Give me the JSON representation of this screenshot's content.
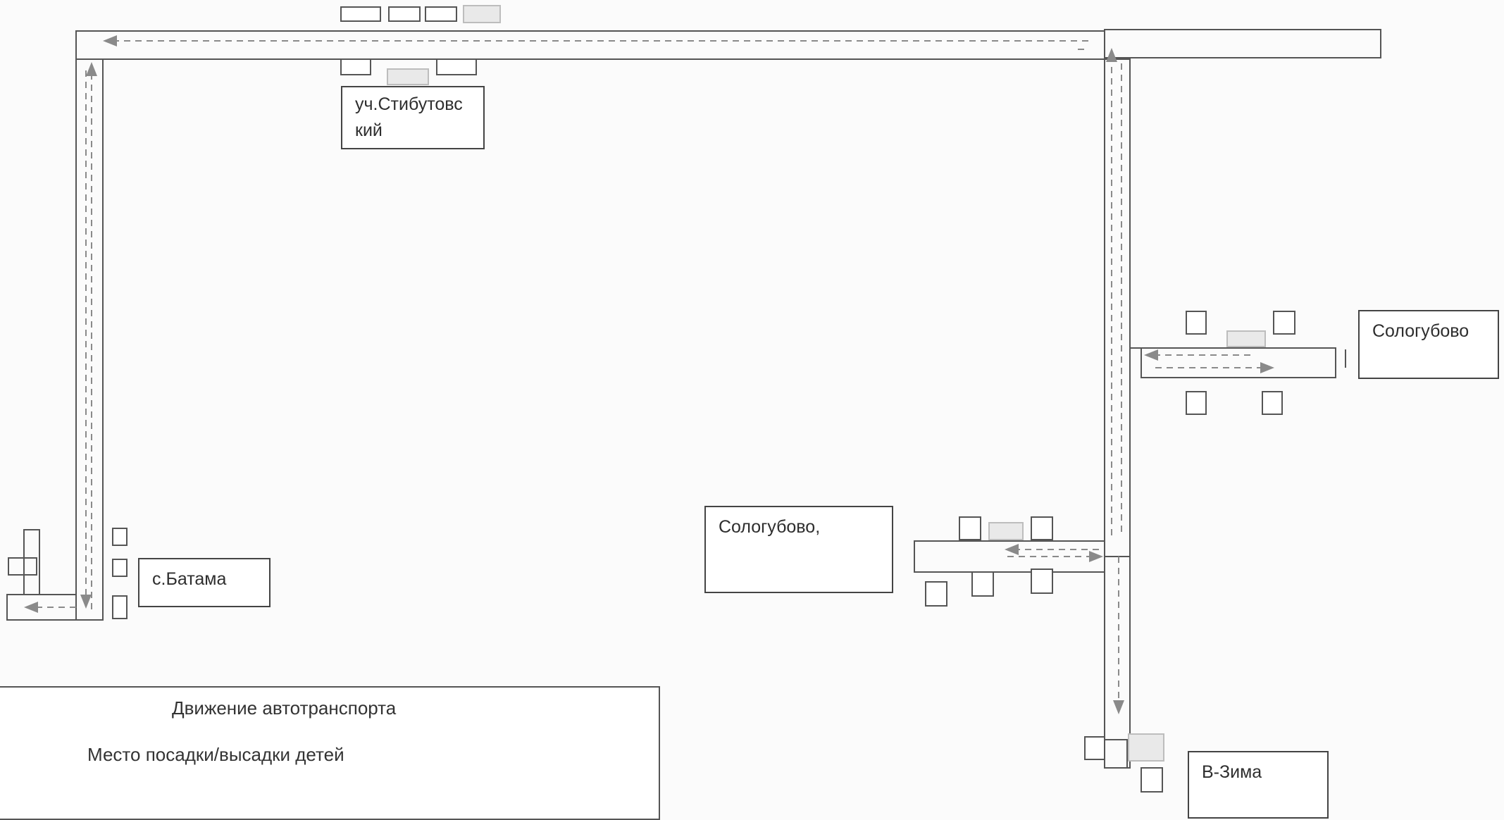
{
  "labels": {
    "stibutovsky": "уч.Стибутовс кий",
    "batama": "с.Батама",
    "sologubovo_east": "Сологубово",
    "sologubovo_center": "Сологубово,",
    "v_zima": "В-Зима"
  },
  "legend": {
    "traffic": "Движение автотранспорта",
    "bus_stop": "Место посадки/высадки детей"
  },
  "colors": {
    "road_outline": "#555555",
    "route_arrow": "#8a8a8a",
    "bus_stop_fill": "#e6e6e6",
    "label_border": "#444444"
  }
}
